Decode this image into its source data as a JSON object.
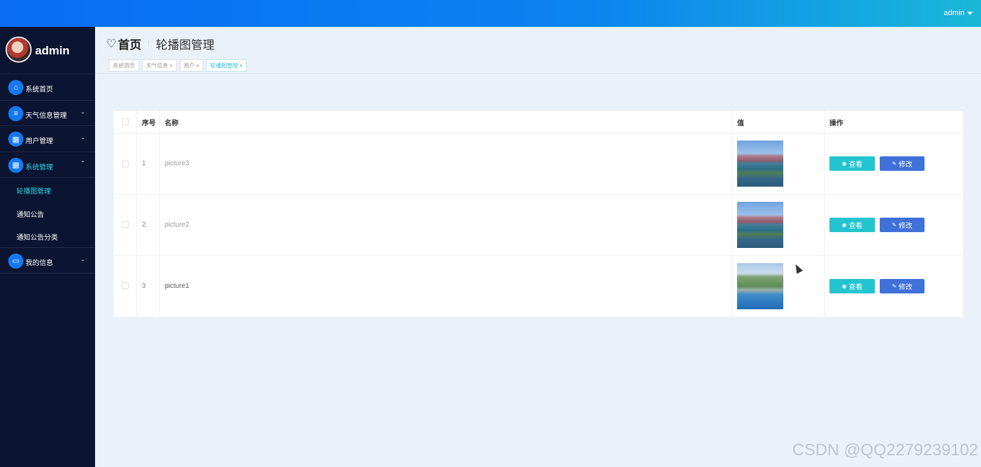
{
  "topbar": {
    "user": "admin"
  },
  "sidebar": {
    "profile_name": "admin",
    "items": [
      {
        "label": "系统首页",
        "icon": "home-icon"
      },
      {
        "label": "天气信息管理",
        "icon": "sliders-icon"
      },
      {
        "label": "用户管理",
        "icon": "grid-icon"
      },
      {
        "label": "系统管理",
        "icon": "apps-icon"
      },
      {
        "label": "我的信息",
        "icon": "card-icon"
      }
    ],
    "sub_items": [
      "轮播图管理",
      "通知公告",
      "通知公告分类"
    ]
  },
  "breadcrumb": {
    "home": "首页",
    "current": "轮播图管理"
  },
  "tags": [
    "系统首页",
    "天气信息",
    "用户",
    "轮播图管理"
  ],
  "table": {
    "headers": [
      "序号",
      "名称",
      "值",
      "操作"
    ],
    "rows": [
      {
        "no": "1",
        "name": "picture3"
      },
      {
        "no": "2",
        "name": "picture2"
      },
      {
        "no": "3",
        "name": "picture1"
      }
    ],
    "view_label": "查看",
    "edit_label": "修改"
  },
  "watermark": "CSDN @QQ2279239102"
}
